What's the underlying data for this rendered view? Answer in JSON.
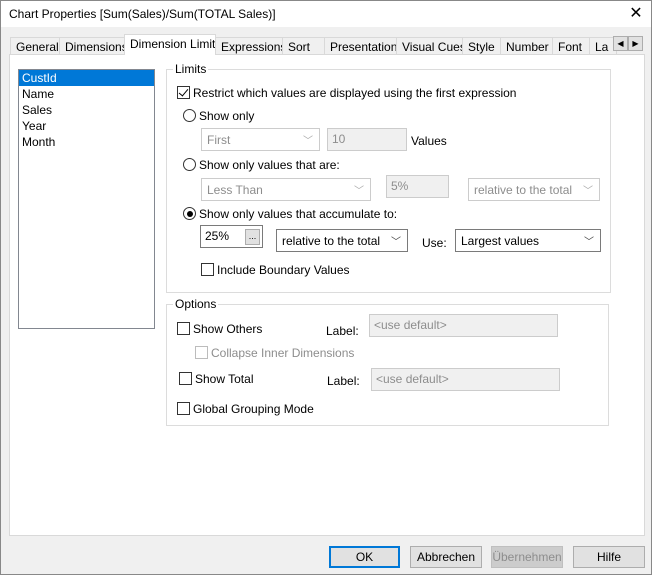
{
  "window": {
    "title": "Chart Properties [Sum(Sales)/Sum(TOTAL Sales)]",
    "close_icon": "close-icon"
  },
  "tabs": [
    "General",
    "Dimensions",
    "Dimension Limits",
    "Expressions",
    "Sort",
    "Presentation",
    "Visual Cues",
    "Style",
    "Number",
    "Font",
    "La"
  ],
  "selected_tab": "Dimension Limits",
  "dimensions": {
    "items": [
      "CustId",
      "Name",
      "Sales",
      "Year",
      "Month"
    ],
    "selected": "CustId"
  },
  "limits": {
    "title": "Limits",
    "restrict_label": "Restrict which values are displayed using the first expression",
    "restrict_checked": true,
    "show_only_label": "Show only",
    "show_only_mode": "First",
    "show_only_count": "10",
    "values_label": "Values",
    "values_that_are_label": "Show only values that are:",
    "compare_mode": "Less Than",
    "compare_value": "5%",
    "compare_relative": "relative to the total",
    "accumulate_label": "Show only values that accumulate to:",
    "accumulate_value": "25%",
    "ellipsis": "...",
    "accumulate_relative": "relative to the total",
    "use_label": "Use:",
    "use_value": "Largest values",
    "boundary_label": "Include Boundary Values",
    "selected_radio": "accumulate"
  },
  "options": {
    "title": "Options",
    "show_others": "Show Others",
    "label1": "Label:",
    "label1_placeholder": "<use default>",
    "collapse": "Collapse Inner Dimensions",
    "show_total": "Show Total",
    "label2": "Label:",
    "label2_placeholder": "<use default>",
    "global_grouping": "Global Grouping Mode"
  },
  "buttons": {
    "ok": "OK",
    "cancel": "Abbrechen",
    "apply": "Übernehmen",
    "help": "Hilfe"
  },
  "colors": {
    "selection": "#0078d7"
  }
}
